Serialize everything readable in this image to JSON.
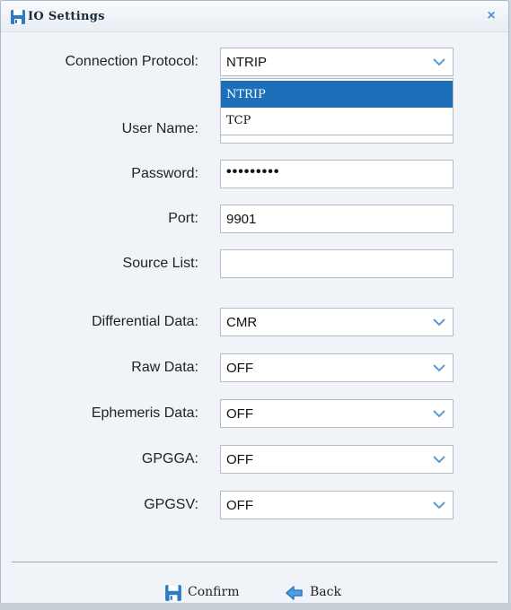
{
  "window": {
    "title": "IO Settings",
    "close_symbol": "×"
  },
  "form": {
    "connection_protocol": {
      "label": "Connection Protocol:",
      "value": "NTRIP",
      "options": [
        "NTRIP",
        "TCP"
      ],
      "selected_option": "NTRIP"
    },
    "user_name": {
      "label": "User Name:",
      "value": ""
    },
    "password": {
      "label": "Password:",
      "value": "•••••••••"
    },
    "port": {
      "label": "Port:",
      "value": "9901"
    },
    "source_list": {
      "label": "Source List:",
      "value": ""
    },
    "differential_data": {
      "label": "Differential Data:",
      "value": "CMR"
    },
    "raw_data": {
      "label": "Raw Data:",
      "value": "OFF"
    },
    "ephemeris_data": {
      "label": "Ephemeris Data:",
      "value": "OFF"
    },
    "gpgga": {
      "label": "GPGGA:",
      "value": "OFF"
    },
    "gpgsv": {
      "label": "GPGSV:",
      "value": "OFF"
    }
  },
  "footer": {
    "confirm_label": "Confirm",
    "back_label": "Back"
  },
  "colors": {
    "accent": "#1c6fb8",
    "chevron": "#5b9bd5",
    "background": "#f0f4f8"
  }
}
